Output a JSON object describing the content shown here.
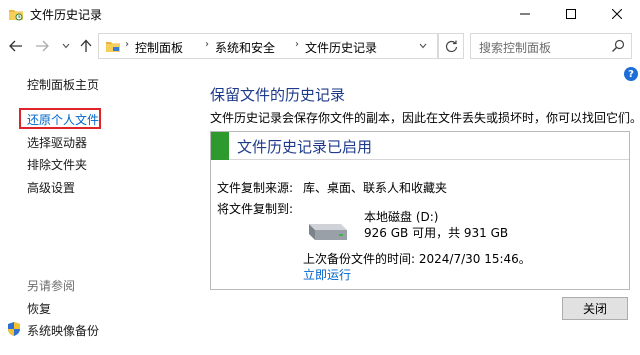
{
  "window": {
    "title": "文件历史记录"
  },
  "address": {
    "crumbs": [
      "控制面板",
      "系统和安全",
      "文件历史记录"
    ],
    "search_placeholder": "搜索控制面板"
  },
  "sidebar": {
    "home": "控制面板主页",
    "links": [
      "还原个人文件",
      "选择驱动器",
      "排除文件夹",
      "高级设置"
    ],
    "see_also_heading": "另请参阅",
    "see_also": [
      "恢复",
      "系统映像备份"
    ]
  },
  "help": {
    "label": "?"
  },
  "main": {
    "title": "保留文件的历史记录",
    "description": "文件历史记录会保存你文件的副本，因此在文件丢失或损坏时，你可以找回它们。",
    "status": "文件历史记录已启用",
    "copy_source_label": "文件复制来源:",
    "copy_source_value": "库、桌面、联系人和收藏夹",
    "copy_to_label": "将文件复制到:",
    "drive_name": "本地磁盘 (D:)",
    "drive_space": "926 GB 可用，共 931 GB",
    "last_backup": "上次备份文件的时间: 2024/7/30 15:46。",
    "run_now": "立即运行"
  },
  "buttons": {
    "close": "关闭"
  },
  "colors": {
    "heading_blue": "#1e3a8a",
    "link_blue": "#0066cc",
    "status_green": "#2e9a2e",
    "selection_red": "#e0242a"
  }
}
